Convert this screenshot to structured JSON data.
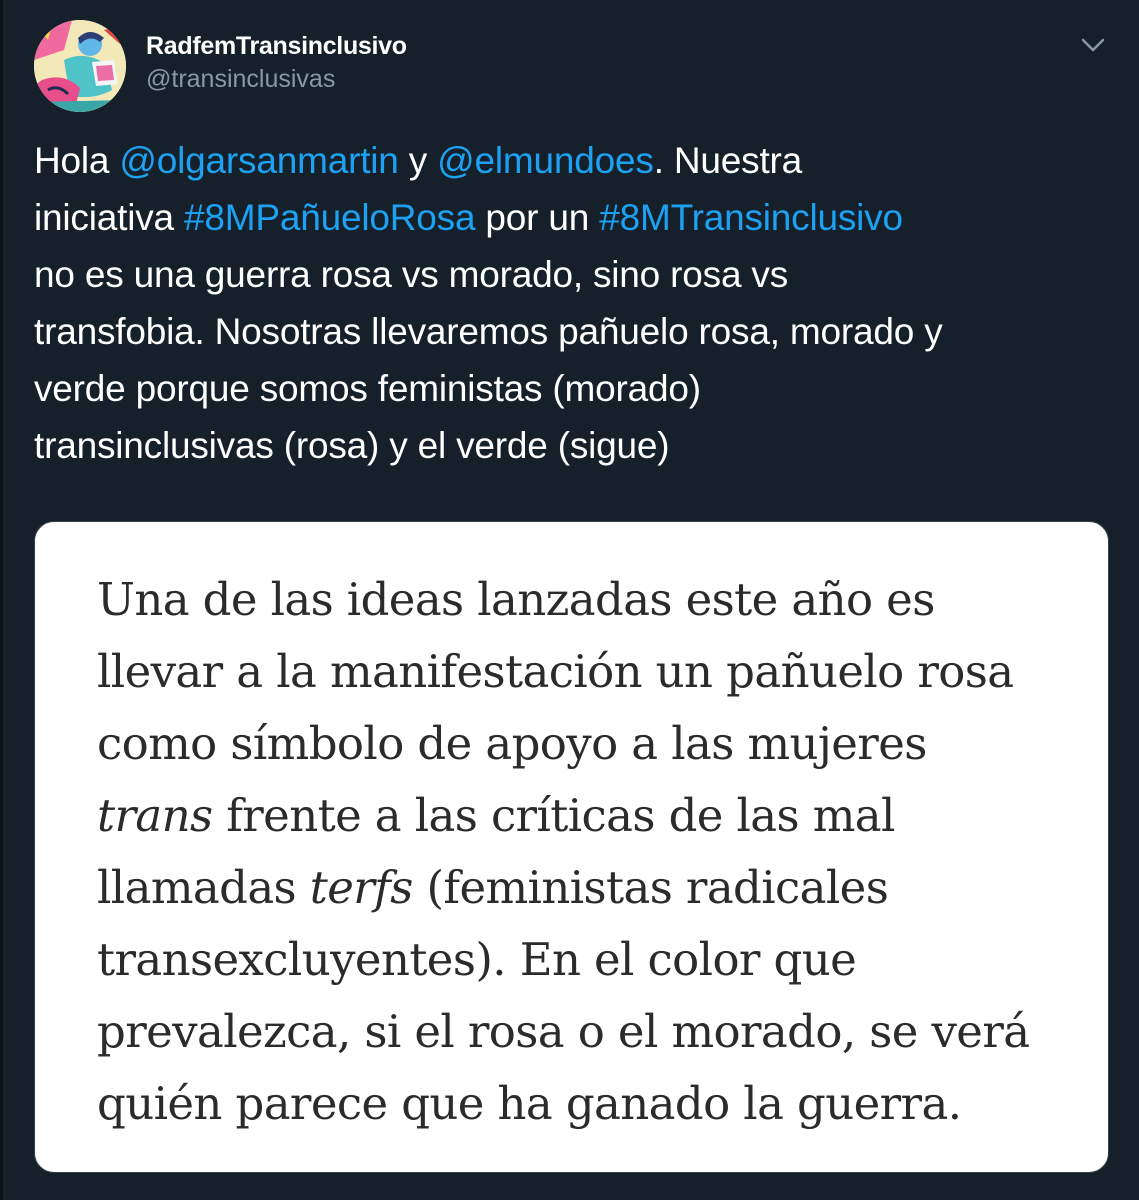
{
  "tweet": {
    "author": {
      "display_name": "RadfemTransinclusivo",
      "handle": "@transinclusivas",
      "avatar_icon": "illustrated-avatar"
    },
    "menu_icon": "chevron-down-icon",
    "text": {
      "l1_a": "Hola ",
      "l1_mention1": "@olgarsanmartin",
      "l1_b": " y ",
      "l1_mention2": "@elmundoes",
      "l1_c": ". Nuestra",
      "l2_a": "iniciativa ",
      "l2_hashtag1": "#8MPañueloRosa",
      "l2_b": " por un ",
      "l2_hashtag2": "#8MTransinclusivo",
      "l3": " no es una guerra rosa vs morado, sino rosa vs",
      "l4": "transfobia. Nosotras llevaremos pañuelo rosa, morado y",
      "l5": "verde porque somos feministas (morado)",
      "l6": "transinclusivas (rosa) y el verde (sigue)"
    }
  },
  "media": {
    "l1": "Una de las ideas lanzadas este año es",
    "l2": "llevar a la manifestación un pañuelo rosa",
    "l3": "como símbolo de apoyo a las mujeres",
    "l4_italic": "trans",
    "l4_rest": " frente a las críticas de las mal",
    "l5_a": "llamadas ",
    "l5_italic": "terfs",
    "l5_b": " (feministas radicales",
    "l6": "transexcluyentes). En el color que",
    "l7": "prevalezca, si el rosa o el morado, se verá",
    "l8": "quién parece que ha ganado la guerra."
  },
  "colors": {
    "background": "#15202b",
    "link": "#1da1f2",
    "secondary_text": "#8899a6",
    "card_background": "#ffffff",
    "card_text": "#2b2b2b"
  }
}
